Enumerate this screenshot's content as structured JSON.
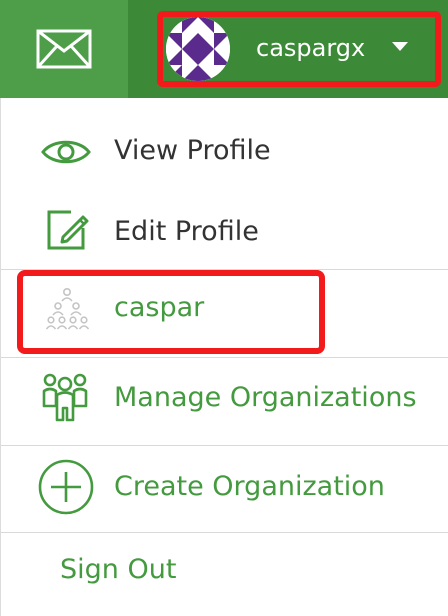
{
  "header": {
    "mail_icon": "envelope-icon",
    "username": "caspargx",
    "avatar": "identicon-avatar",
    "dropdown_icon": "caret-down-icon"
  },
  "menu": {
    "view_profile": {
      "label": "View Profile",
      "icon": "eye-icon"
    },
    "edit_profile": {
      "label": "Edit Profile",
      "icon": "edit-icon"
    },
    "org_caspar": {
      "label": "caspar",
      "icon": "org-chart-icon"
    },
    "manage_orgs": {
      "label": "Manage Organizations",
      "icon": "people-group-icon"
    },
    "create_org": {
      "label": "Create Organization",
      "icon": "plus-circle-icon"
    },
    "sign_out": {
      "label": "Sign Out"
    }
  },
  "colors": {
    "header_green": "#3f8f3c",
    "accent_green": "#449a3e",
    "highlight_red": "#f21a1a"
  }
}
